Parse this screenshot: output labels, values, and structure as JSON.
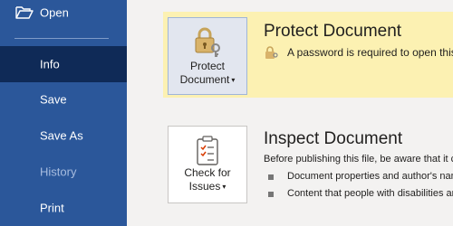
{
  "sidebar": {
    "items": [
      {
        "label": "Open"
      },
      {
        "label": "Info"
      },
      {
        "label": "Save"
      },
      {
        "label": "Save As"
      },
      {
        "label": "History"
      },
      {
        "label": "Print"
      }
    ],
    "selected": "Info"
  },
  "protect": {
    "button_line1": "Protect",
    "button_line2": "Document",
    "title": "Protect Document",
    "message": "A password is required to open this document."
  },
  "inspect": {
    "button_line1": "Check for",
    "button_line2": "Issues",
    "title": "Inspect Document",
    "description": "Before publishing this file, be aware that it contains:",
    "bullets": [
      "Document properties and author's name",
      "Content that people with disabilities are unable to read"
    ]
  },
  "colors": {
    "sidebar_bg": "#2b579a",
    "selected_bg": "#0f2a57",
    "protect_band": "#fcf1b2",
    "content_bg": "#f3f2f1"
  },
  "icons": [
    "folder-open-icon",
    "lock-key-icon",
    "checklist-icon",
    "dropdown-caret-icon"
  ]
}
